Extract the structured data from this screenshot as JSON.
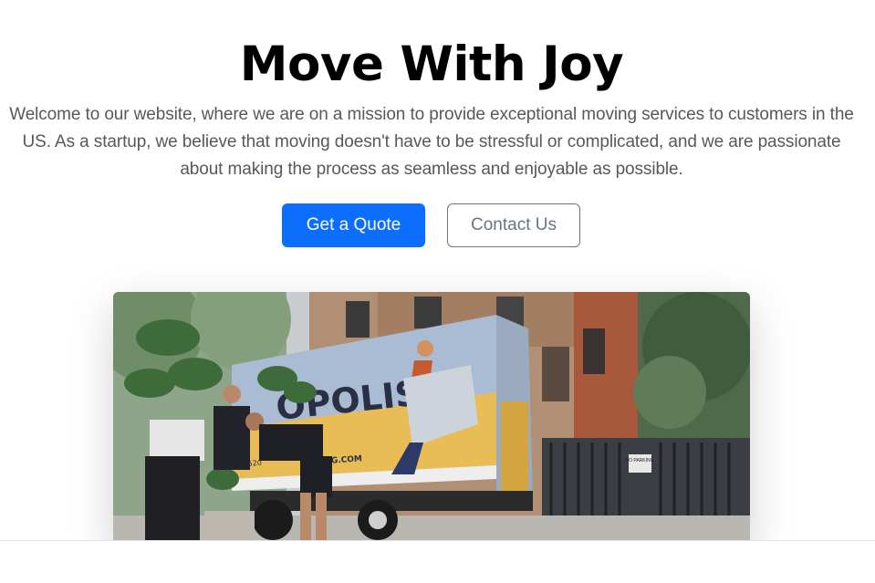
{
  "hero": {
    "title": "Move With Joy",
    "lead": "Welcome to our website, where we are on a mission to provide exceptional moving services to customers in the US. As a startup, we believe that moving doesn't have to be stressful or complicated, and we are passionate about making the process as seamless and enjoyable as possible.",
    "primary_button": "Get a Quote",
    "secondary_button": "Contact Us"
  },
  "photo": {
    "truck_brand": "OPOLIS",
    "truck_web": "MOVING.COM",
    "truck_phone": "18) 520",
    "sign_text": "NO PARKING"
  },
  "colors": {
    "primary": "#0d6efd",
    "secondary": "#6c757d",
    "truck_yellow": "#e9bd55",
    "truck_blue": "#a9bcd4"
  }
}
